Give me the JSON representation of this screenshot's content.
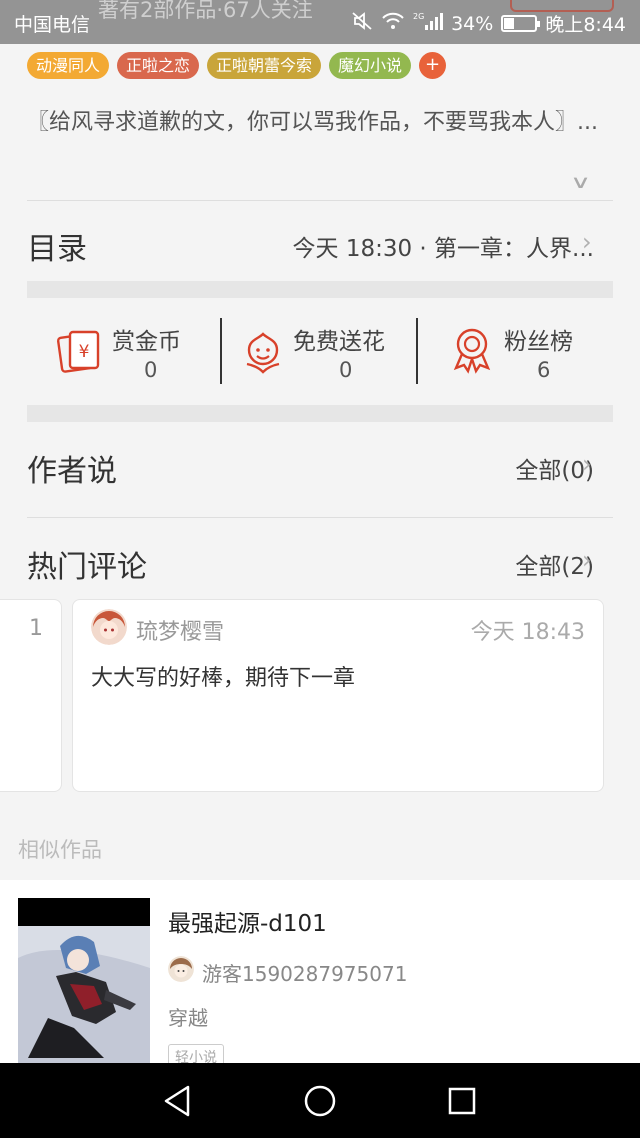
{
  "status_bar": {
    "carrier": "中国电信",
    "peek_text": "著有2部作品·67人关注",
    "network": "2G",
    "battery": "34%",
    "battery_level": 0.34,
    "time": "晚上8:44"
  },
  "tags": [
    {
      "label": "动漫同人",
      "color": "#f3a933"
    },
    {
      "label": "正啦之恋",
      "color": "#d9684d"
    },
    {
      "label": "正啦朝蕾今索",
      "color": "#c9a53a"
    },
    {
      "label": "魔幻小说",
      "color": "#93b84f"
    }
  ],
  "add_tag": "+",
  "description": "〖给风寻求道歉的文，你可以骂我作品，不要骂我本人〗...",
  "catalog": {
    "title": "目录",
    "latest": "今天 18:30 · 第一章：人界..."
  },
  "stats": [
    {
      "label": "赏金币",
      "value": "0",
      "icon": "red-envelope-icon"
    },
    {
      "label": "免费送花",
      "value": "0",
      "icon": "flower-icon"
    },
    {
      "label": "粉丝榜",
      "value": "6",
      "icon": "medal-icon"
    }
  ],
  "author_says": {
    "title": "作者说",
    "link": "全部(0)"
  },
  "hot_comments": {
    "title": "热门评论",
    "link": "全部(2)",
    "prev_card_fragment": "1",
    "comment": {
      "user": "琉梦樱雪",
      "time": "今天 18:43",
      "text": "大大写的好棒，期待下一章"
    }
  },
  "similar": {
    "label": "相似作品",
    "book": {
      "title": "最强起源-d101",
      "author": "游客1590287975071",
      "genre": "穿越",
      "tag": "轻小说"
    }
  },
  "colors": {
    "accent": "#e8623a",
    "icon_red": "#d8412a"
  }
}
